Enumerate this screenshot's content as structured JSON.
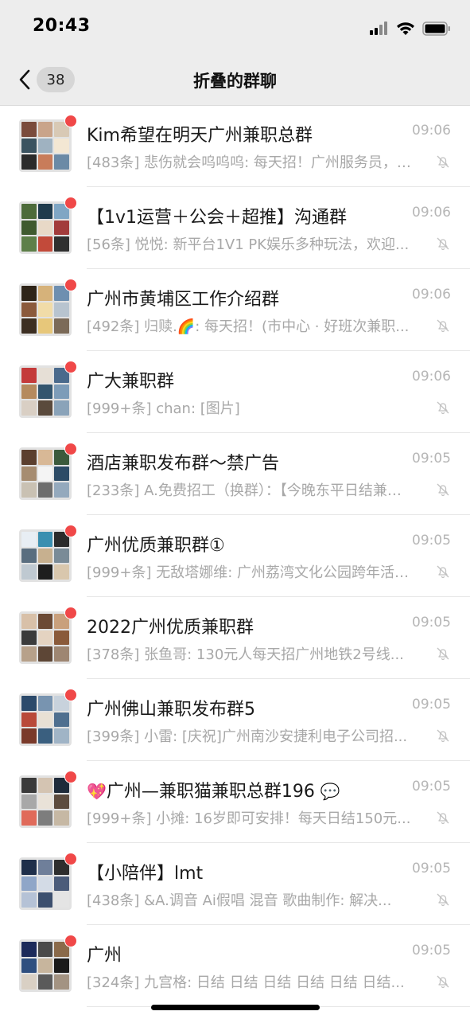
{
  "status_bar": {
    "time": "20:43"
  },
  "nav": {
    "back_count": "38",
    "title": "折叠的群聊"
  },
  "chats": [
    {
      "name": "Kim希望在明天广州兼职总群",
      "preview": "[483条] 悲伤就会呜呜呜: 每天招！广州服务员，兼职...",
      "time": "09:06"
    },
    {
      "name": "【1v1运营＋公会＋超推】沟通群",
      "preview": "[56条] 悦悦: 新平台1V1  PK娱乐多种玩法，欢迎...",
      "time": "09:06"
    },
    {
      "name": "广州市黄埔区工作介绍群",
      "preview": "[492条] 归赎.🌈: 每天招！(市中心 · 好班次兼职...",
      "time": "09:06"
    },
    {
      "name": "广大兼职群",
      "preview": "[999+条] chan: [图片]",
      "time": "09:06"
    },
    {
      "name": "酒店兼职发布群～禁广告",
      "preview": "[233条] A.免费招工（换群）：【今晚东平日结兼职...",
      "time": "09:05"
    },
    {
      "name": "广州优质兼职群①",
      "preview": "[999+条] 无敌塔娜维: 广州荔湾文化公园跨年活动...",
      "time": "09:05"
    },
    {
      "name": "2022广州优质兼职群",
      "preview": "[378条] 张鱼哥: 130元人每天招广州地铁2号线...",
      "time": "09:05"
    },
    {
      "name": "广州佛山兼职发布群5",
      "preview": "[399条] 小雷: [庆祝]广州南沙安捷利电子公司招...",
      "time": "09:05"
    },
    {
      "name_emoji": "💖",
      "name": "广州—兼职猫兼职总群196",
      "name_suffix": "💬",
      "preview": "[999+条] 小摊: 16岁即可安排！每天日结150元...",
      "time": "09:05"
    },
    {
      "name": "【小陪伴】lmt",
      "preview": "[438条] &A.调音 Ai假唱 混音  歌曲制作: 解决...",
      "time": "09:05"
    },
    {
      "name": "广州",
      "preview": "[324条] 九宫格: 日结 日结 日结 日结 日结 日结...",
      "time": "09:05"
    }
  ],
  "icons": {
    "back": "chevron-left-icon",
    "mute": "bell-slash-icon",
    "signal": "cellular-signal-icon",
    "wifi": "wifi-icon",
    "battery": "battery-icon"
  },
  "colors": {
    "bar_bg": "#ededed",
    "unread_dot": "#f04848",
    "preview_text": "#a8a8a8",
    "time_text": "#b6b6b6"
  }
}
